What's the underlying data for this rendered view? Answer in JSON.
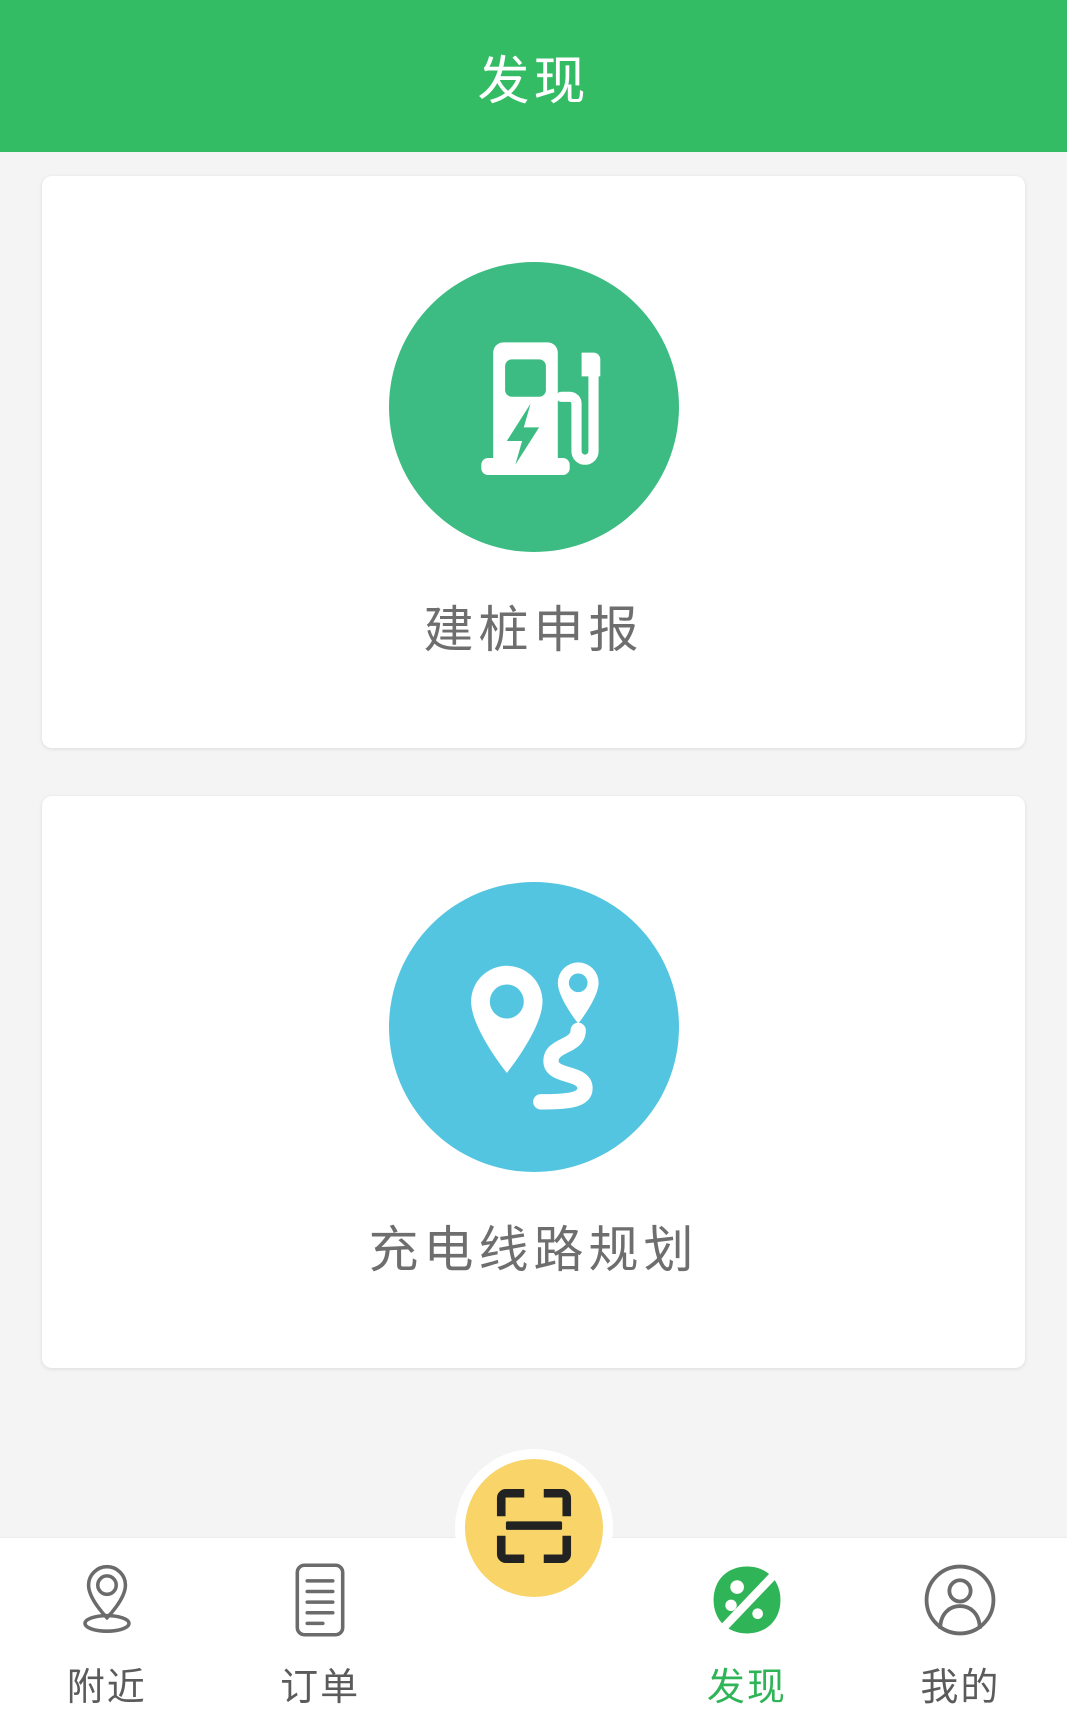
{
  "header": {
    "title": "发现",
    "background_color": "#33bc64",
    "text_color": "#ffffff"
  },
  "main": {
    "cards": [
      {
        "label": "建桩申报",
        "icon": "charging-pile-icon",
        "circle_color": "#3cbc82"
      },
      {
        "label": "充电线路规划",
        "icon": "route-planning-icon",
        "circle_color": "#54c5e0"
      }
    ]
  },
  "tabbar": {
    "active_color": "#2fb457",
    "inactive_color": "#5b5b5b",
    "scan_button": {
      "icon": "scan-qr-icon",
      "color": "#f8d469"
    },
    "items": [
      {
        "label": "附近",
        "icon": "location-pin-icon",
        "active": false
      },
      {
        "label": "订单",
        "icon": "order-document-icon",
        "active": false
      },
      {
        "label": "发现",
        "icon": "discover-leaf-icon",
        "active": true
      },
      {
        "label": "我的",
        "icon": "user-profile-icon",
        "active": false
      }
    ]
  }
}
